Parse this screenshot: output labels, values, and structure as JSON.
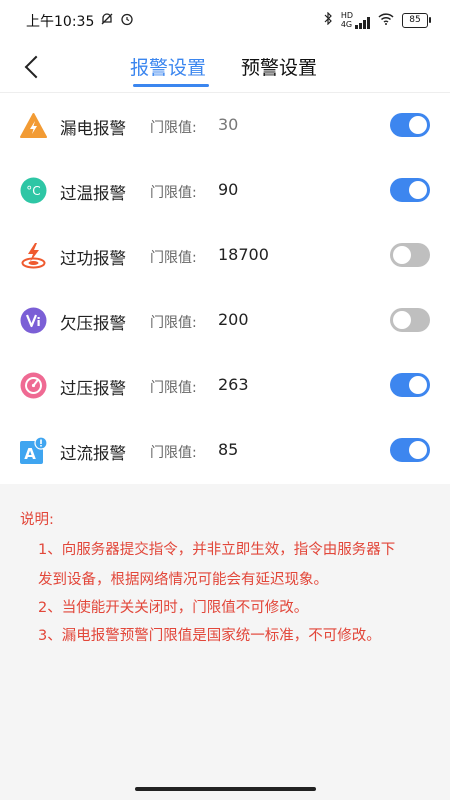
{
  "status_bar": {
    "time": "上午10:35",
    "battery": "85"
  },
  "header": {
    "tab_active": "报警设置",
    "tab_inactive": "预警设置"
  },
  "alarms": [
    {
      "name": "漏电报警",
      "threshold_label": "门限值:",
      "value": "30",
      "enabled": true,
      "icon": "leakage-warning-icon",
      "color": "#f29b34"
    },
    {
      "name": "过温报警",
      "threshold_label": "门限值:",
      "value": "90",
      "enabled": true,
      "icon": "celsius-temperature-icon",
      "color": "#2ec6a5"
    },
    {
      "name": "过功报警",
      "threshold_label": "门限值:",
      "value": "18700",
      "enabled": false,
      "icon": "power-lightning-icon",
      "color": "#ef5a2f"
    },
    {
      "name": "欠压报警",
      "threshold_label": "门限值:",
      "value": "200",
      "enabled": false,
      "icon": "undervoltage-icon",
      "color": "#7b5fd6"
    },
    {
      "name": "过压报警",
      "threshold_label": "门限值:",
      "value": "263",
      "enabled": true,
      "icon": "overvoltage-gauge-icon",
      "color": "#ef6a93"
    },
    {
      "name": "过流报警",
      "threshold_label": "门限值:",
      "value": "85",
      "enabled": true,
      "icon": "overcurrent-alert-icon",
      "color": "#3fa5f0"
    }
  ],
  "notes": {
    "title": "说明:",
    "lines": [
      "1、向服务器提交指令，并非立即生效，指令由服务器下",
      "发到设备，根据网络情况可能会有延迟现象。",
      "2、当使能开关关闭时，门限值不可修改。",
      "3、漏电报警预警门限值是国家统一标准，不可修改。"
    ]
  },
  "colors": {
    "accent": "#3b86ef",
    "note_text": "#e2473a",
    "toggle_off": "#bfbfbf"
  }
}
